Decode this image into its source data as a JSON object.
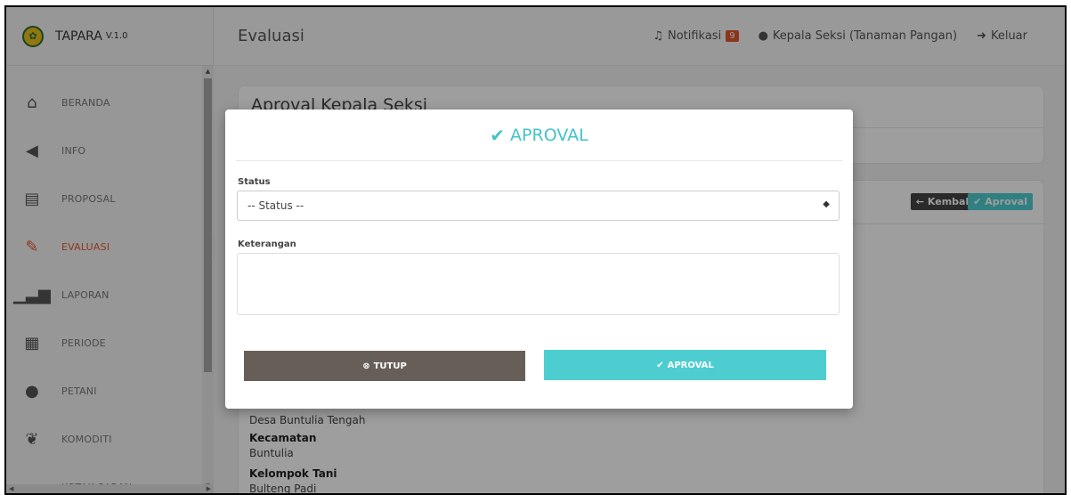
{
  "app": {
    "name": "TAPARA",
    "version": "V.1.0"
  },
  "sidebar": {
    "items": [
      {
        "label": "BERANDA",
        "icon": "home-icon"
      },
      {
        "label": "INFO",
        "icon": "megaphone-icon"
      },
      {
        "label": "PROPOSAL",
        "icon": "document-icon"
      },
      {
        "label": "EVALUASI",
        "icon": "edit-icon",
        "active": true
      },
      {
        "label": "LAPORAN",
        "icon": "bar-chart-icon"
      },
      {
        "label": "PERIODE",
        "icon": "calendar-icon"
      },
      {
        "label": "PETANI",
        "icon": "user-group-icon"
      },
      {
        "label": "KOMODITI",
        "icon": "sprout-icon"
      },
      {
        "label": "KOTAK SARAN",
        "icon": "inbox-icon"
      }
    ]
  },
  "topbar": {
    "title": "Evaluasi",
    "notification_label": "Notifikasi",
    "notification_count": "9",
    "user_label": "Kepala Seksi (Tanaman Pangan)",
    "logout_label": "Keluar"
  },
  "content": {
    "card_title": "Aproval Kepala Seksi",
    "back_label": "← Kembali",
    "aproval_label": "Aproval",
    "details": {
      "desa_value": "Desa Buntulia Tengah",
      "kecamatan_label": "Kecamatan",
      "kecamatan_value": "Buntulia",
      "kelompok_label": "Kelompok Tani",
      "kelompok_value": "Bulteng Padi"
    }
  },
  "modal": {
    "title": "APROVAL",
    "status_label": "Status",
    "status_value": "-- Status --",
    "keterangan_label": "Keterangan",
    "close_label": "TUTUP",
    "submit_label": "APROVAL"
  },
  "colors": {
    "accent": "#4ecdd0",
    "active": "#e25a2c",
    "close_button": "#675f57"
  }
}
